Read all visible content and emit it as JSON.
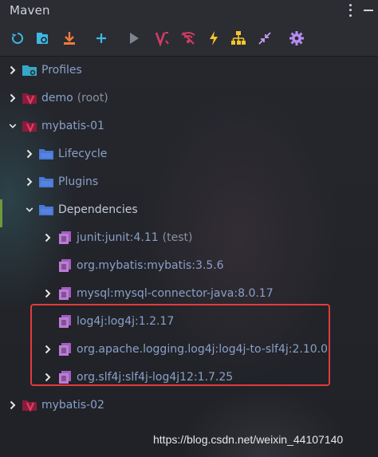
{
  "window": {
    "title": "Maven"
  },
  "toolbar": {
    "buttons": [
      {
        "name": "reload-all-icon",
        "color": "#3fb7e6"
      },
      {
        "name": "generate-sources-icon",
        "color": "#3fb7e6"
      },
      {
        "name": "download-sources-icon",
        "color": "#f07a3a"
      },
      {
        "name": "add-project-icon",
        "color": "#3fb7e6"
      },
      {
        "name": "run-icon",
        "color": "#7f8590"
      },
      {
        "name": "execute-goal-icon",
        "color": "#d63b63"
      },
      {
        "name": "skip-tests-icon",
        "color": "#d63b63"
      },
      {
        "name": "offline-mode-icon",
        "color": "#f5c52c"
      },
      {
        "name": "show-dependencies-icon",
        "color": "#f5c52c"
      },
      {
        "name": "collapse-all-icon",
        "color": "#c89cf2"
      },
      {
        "name": "settings-icon",
        "color": "#b88cf5"
      }
    ]
  },
  "tree": {
    "items": [
      {
        "label": "Profiles",
        "suffix": "",
        "icon": "profiles-folder-icon",
        "expanded": false
      },
      {
        "label": "demo",
        "suffix": "(root)",
        "icon": "maven-project-icon",
        "expanded": false
      },
      {
        "label": "mybatis-01",
        "suffix": "",
        "icon": "maven-project-icon",
        "expanded": true
      },
      {
        "label": "Lifecycle",
        "suffix": "",
        "icon": "folder-icon",
        "expanded": false
      },
      {
        "label": "Plugins",
        "suffix": "",
        "icon": "folder-icon",
        "expanded": false
      },
      {
        "label": "Dependencies",
        "suffix": "",
        "icon": "folder-icon",
        "expanded": true
      },
      {
        "label": "junit:junit:4.11",
        "suffix": "(test)",
        "icon": "library-icon",
        "expanded": false
      },
      {
        "label": "org.mybatis:mybatis:3.5.6",
        "suffix": "",
        "icon": "library-icon",
        "expanded": false
      },
      {
        "label": "mysql:mysql-connector-java:8.0.17",
        "suffix": "",
        "icon": "library-icon",
        "expanded": false
      },
      {
        "label": "log4j:log4j:1.2.17",
        "suffix": "",
        "icon": "library-icon",
        "expanded": false
      },
      {
        "label": "org.apache.logging.log4j:log4j-to-slf4j:2.10.0",
        "suffix": "",
        "icon": "library-icon",
        "expanded": false
      },
      {
        "label": "org.slf4j:slf4j-log4j12:1.7.25",
        "suffix": "",
        "icon": "library-icon",
        "expanded": false
      },
      {
        "label": "mybatis-02",
        "suffix": "",
        "icon": "maven-project-icon",
        "expanded": false
      }
    ]
  },
  "watermark": "https://blog.csdn.net/weixin_44107140",
  "colors": {
    "panel": "#2b2d33",
    "highlight_box": "#e23b3b",
    "folder": "#4a78d6",
    "library": "#c07ad8",
    "maven": "#c8204d"
  }
}
